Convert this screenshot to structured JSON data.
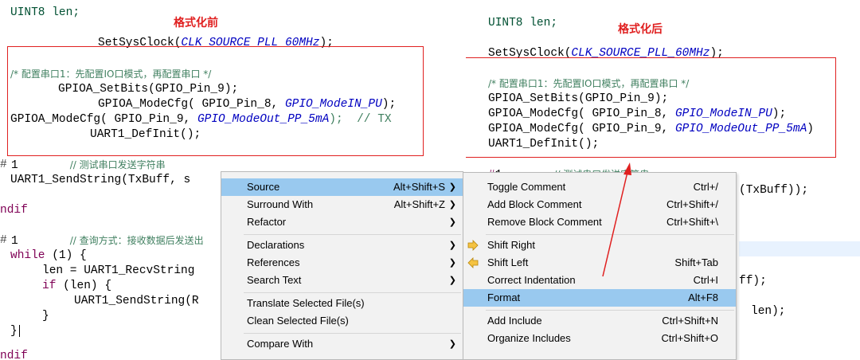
{
  "left_caption": "格式化前",
  "right_caption": "格式化后",
  "left_code": {
    "l1": "UINT8 len;",
    "l2a": "SetSysClock(",
    "l2b": "CLK_SOURCE_PLL_60MHz",
    "l2c": ");",
    "l3": "/* 配置串口1：先配置IO口模式，再配置串口 */",
    "l4": "GPIOA_SetBits(GPIO_Pin_9);",
    "l5a": "GPIOA_ModeCfg( GPIO_Pin_8, ",
    "l5b": "GPIO_ModeIN_PU",
    "l5c": ");",
    "l6a": "GPIOA_ModeCfg( GPIO_Pin_9, ",
    "l6b": "GPIO_ModeOut_PP_5mA",
    "l6c": ");  // TX",
    "l7": "UART1_DefInit();",
    "l8a": "1",
    "l8b": "// 测试串口发送字符串",
    "l9": "UART1_SendString(TxBuff, s",
    "l10": "ndif",
    "l11a": "1",
    "l11b": "// 查询方式：接收数据后发送出",
    "l12a": "while",
    "l12b": " (1) {",
    "l13": "len = UART1_RecvString",
    "l14a": "if",
    "l14b": " (len) {",
    "l15": "UART1_SendString(R",
    "l16": "}",
    "l17": "}",
    "l18": "ndif"
  },
  "right_code": {
    "r1": "UINT8 len;",
    "r2a": "SetSysClock(",
    "r2b": "CLK_SOURCE_PLL_60MHz",
    "r2c": ");",
    "r3": "/* 配置串口1：先配置IO口模式，再配置串口 */",
    "r4": "GPIOA_SetBits(GPIO_Pin_9);",
    "r5a": "GPIOA_ModeCfg( GPIO_Pin_8, ",
    "r5b": "GPIO_ModeIN_PU",
    "r5c": ");",
    "r6a": "GPIOA_ModeCfg( GPIO_Pin_9, ",
    "r6b": "GPIO_ModeOut_PP_5mA",
    "r6c": ")",
    "r7": "UART1_DefInit();",
    "r8a": "1",
    "r8b": "// 测试串口发送字符串",
    "r9": "(TxBuff));",
    "r10": "ff);",
    "r11": "len);"
  },
  "context_menu": {
    "items": [
      {
        "label": "Source",
        "shortcut": "Alt+Shift+S"
      },
      {
        "label": "Surround With",
        "shortcut": "Alt+Shift+Z"
      },
      {
        "label": "Refactor",
        "shortcut": ""
      },
      {
        "label": "Declarations",
        "shortcut": ""
      },
      {
        "label": "References",
        "shortcut": ""
      },
      {
        "label": "Search Text",
        "shortcut": ""
      },
      {
        "label": "Translate Selected File(s)",
        "shortcut": ""
      },
      {
        "label": "Clean Selected File(s)",
        "shortcut": ""
      },
      {
        "label": "Compare With",
        "shortcut": ""
      }
    ]
  },
  "source_submenu": {
    "items": [
      {
        "label": "Toggle Comment",
        "shortcut": "Ctrl+/"
      },
      {
        "label": "Add Block Comment",
        "shortcut": "Ctrl+Shift+/"
      },
      {
        "label": "Remove Block Comment",
        "shortcut": "Ctrl+Shift+\\"
      },
      {
        "label": "Shift Right",
        "shortcut": ""
      },
      {
        "label": "Shift Left",
        "shortcut": "Shift+Tab"
      },
      {
        "label": "Correct Indentation",
        "shortcut": "Ctrl+I"
      },
      {
        "label": "Format",
        "shortcut": "Alt+F8"
      },
      {
        "label": "Add Include",
        "shortcut": "Ctrl+Shift+N"
      },
      {
        "label": "Organize Includes",
        "shortcut": "Ctrl+Shift+O"
      }
    ]
  },
  "colors": {
    "annotation": "#e02020",
    "menu_highlight": "#99c9ef",
    "keyword": "#7f0055",
    "enum_constant": "#0000c0",
    "comment": "#3f7f5f"
  }
}
